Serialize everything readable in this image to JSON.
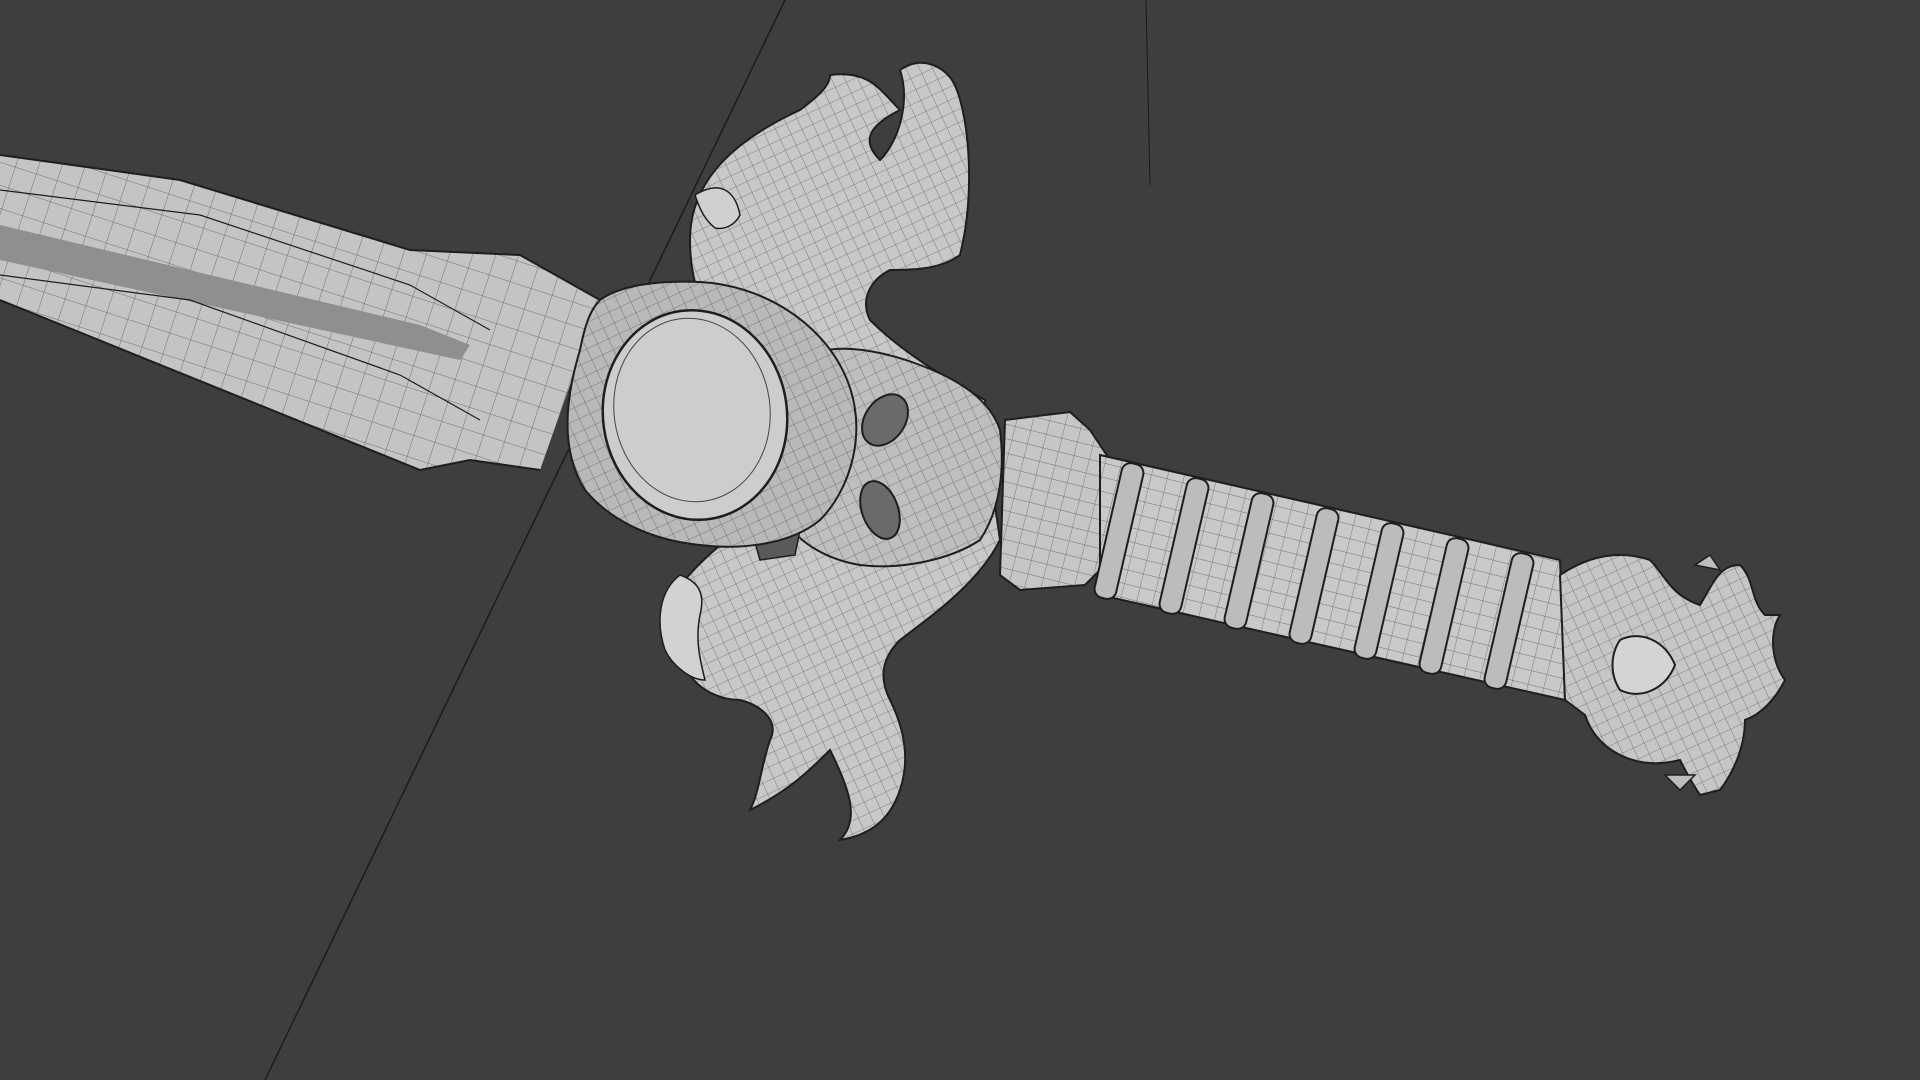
{
  "viewport": {
    "background_color": "#3e3e3e",
    "mesh_fill_color": "#c9c9c9",
    "mesh_shadow_color": "#8e8e8e",
    "wire_color": "#1e1e1e",
    "guide_line_color": "#1a1a1a"
  },
  "object": {
    "name_hint": "sword-mesh",
    "display_mode": "wireframe-overlay",
    "parts": [
      "blade",
      "fuller",
      "crossguard",
      "center-disc",
      "grip",
      "grip-rings",
      "pommel"
    ]
  }
}
